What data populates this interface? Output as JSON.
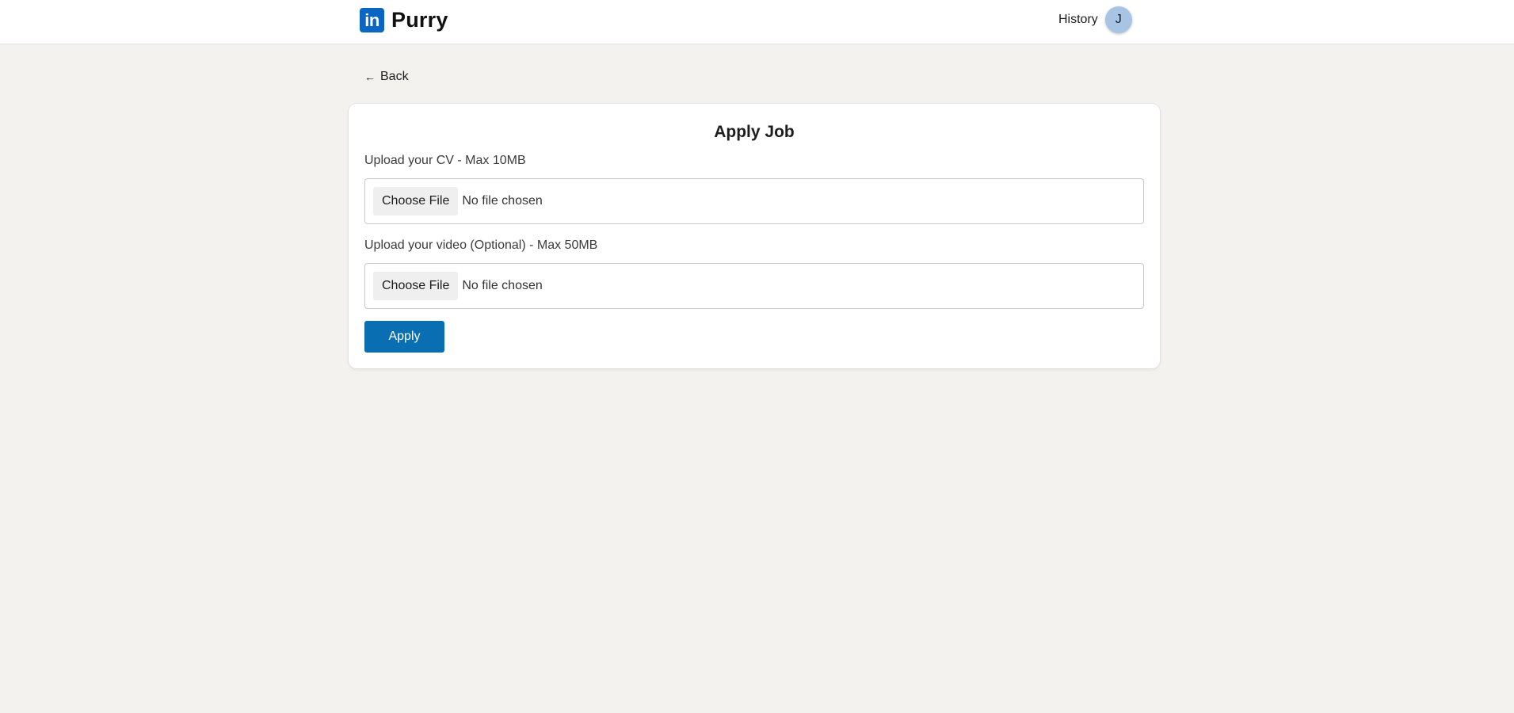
{
  "header": {
    "brand_logo_text": "in",
    "brand_name": "Purry",
    "history_label": "History",
    "avatar_initial": "J",
    "brand_color": "#0a66c2"
  },
  "back": {
    "arrow": "←",
    "label": "Back"
  },
  "form": {
    "title": "Apply Job",
    "cv": {
      "label": "Upload your CV - Max 10MB",
      "button_label": "Choose File",
      "status": "No file chosen"
    },
    "video": {
      "label": "Upload your video (Optional) - Max 50MB",
      "button_label": "Choose File",
      "status": "No file chosen"
    },
    "submit_label": "Apply",
    "submit_color": "#0a6eb3"
  }
}
